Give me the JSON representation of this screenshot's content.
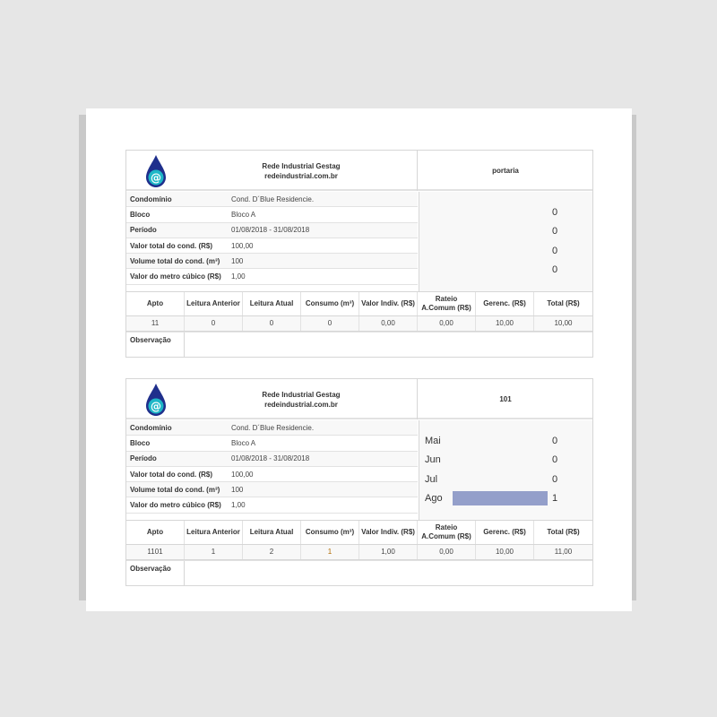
{
  "bills": [
    {
      "company_name": "Rede Industrial Gestag",
      "company_site": "redeindustrial.com.br",
      "unit_title": "portaria",
      "info": [
        {
          "label": "Condomínio",
          "value": "Cond. D´Blue Residencie."
        },
        {
          "label": "Bloco",
          "value": "Bloco A"
        },
        {
          "label": "Período",
          "value": "01/08/2018 - 31/08/2018"
        },
        {
          "label": "Valor total do cond. (R$)",
          "value": "100,00"
        },
        {
          "label": "Volume total do cond. (m³)",
          "value": "100"
        },
        {
          "label": "Valor do metro cúbico (R$)",
          "value": "1,00"
        }
      ],
      "history": [
        {
          "month": "",
          "value": 0
        },
        {
          "month": "",
          "value": 0
        },
        {
          "month": "",
          "value": 0
        },
        {
          "month": "",
          "value": 0
        }
      ],
      "columns": [
        "Apto",
        "Leitura Anterior",
        "Leitura Atual",
        "Consumo (m³)",
        "Valor Indiv. (R$)",
        "Rateio A.Comum (R$)",
        "Gerenc. (R$)",
        "Total (R$)"
      ],
      "row": [
        "11",
        "0",
        "0",
        "0",
        "0,00",
        "0,00",
        "10,00",
        "10,00"
      ],
      "obs_label": "Observação"
    },
    {
      "company_name": "Rede Industrial Gestag",
      "company_site": "redeindustrial.com.br",
      "unit_title": "101",
      "info": [
        {
          "label": "Condomínio",
          "value": "Cond. D´Blue Residencie."
        },
        {
          "label": "Bloco",
          "value": "Bloco A"
        },
        {
          "label": "Período",
          "value": "01/08/2018 - 31/08/2018"
        },
        {
          "label": "Valor total do cond. (R$)",
          "value": "100,00"
        },
        {
          "label": "Volume total do cond. (m³)",
          "value": "100"
        },
        {
          "label": "Valor do metro cúbico (R$)",
          "value": "1,00"
        }
      ],
      "history": [
        {
          "month": "Mai",
          "value": 0
        },
        {
          "month": "Jun",
          "value": 0
        },
        {
          "month": "Jul",
          "value": 0
        },
        {
          "month": "Ago",
          "value": 1
        }
      ],
      "columns": [
        "Apto",
        "Leitura Anterior",
        "Leitura Atual",
        "Consumo (m³)",
        "Valor Indiv. (R$)",
        "Rateio A.Comum (R$)",
        "Gerenc. (R$)",
        "Total (R$)"
      ],
      "row": [
        "1101",
        "1",
        "2",
        "1",
        "1,00",
        "0,00",
        "10,00",
        "11,00"
      ],
      "obs_label": "Observação"
    }
  ],
  "colors": {
    "bar": "#949fca",
    "logo_dark": "#1f2f8c",
    "logo_teal": "#1fb7c7"
  },
  "icons": {
    "logo": "water-drop-at-icon"
  }
}
